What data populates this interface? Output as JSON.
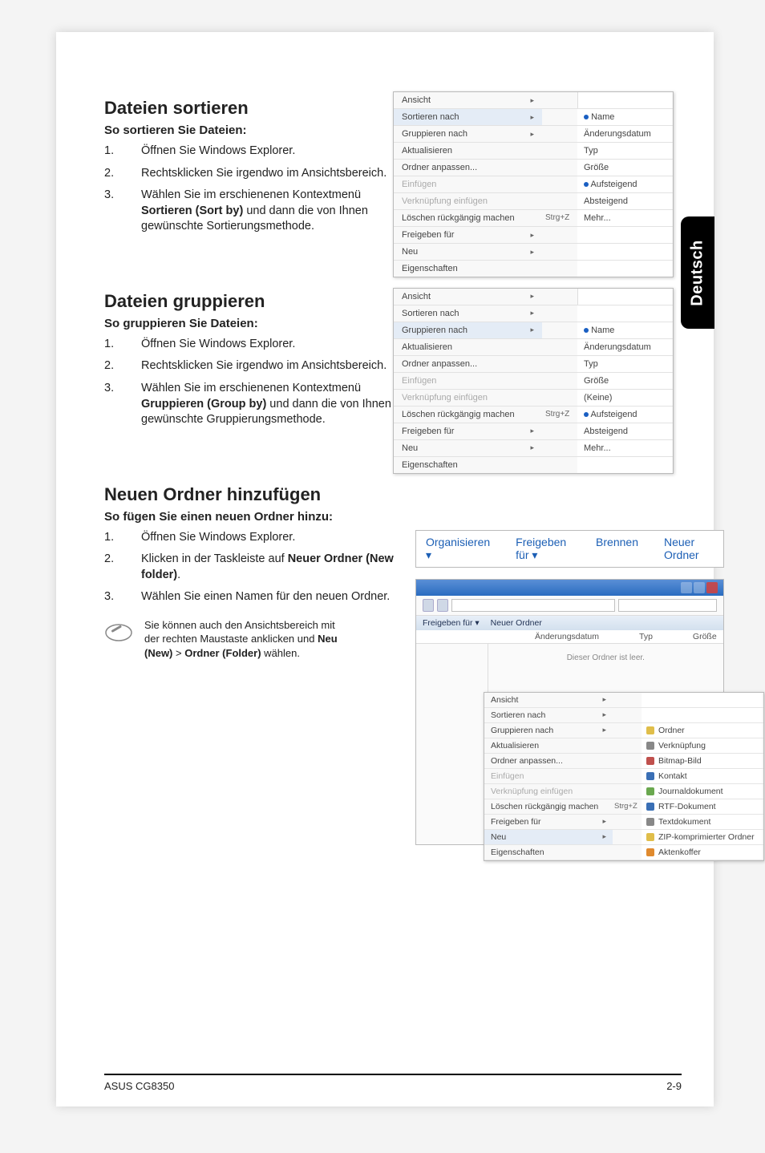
{
  "sideTab": "Deutsch",
  "sections": {
    "sort": {
      "heading": "Dateien sortieren",
      "subheading": "So sortieren Sie Dateien:",
      "steps": [
        "Öffnen Sie Windows Explorer.",
        "Rechtsklicken Sie irgendwo im Ansichtsbereich.",
        "Wählen Sie im erschienenen Kontextmenü Sortieren (Sort by) und dann die von Ihnen gewünschte Sortierungsmethode."
      ],
      "step3_pre": "Wählen Sie im erschienenen Kontextmenü ",
      "step3_bold": "Sortieren (Sort by)",
      "step3_post": " und dann die von Ihnen gewünschte Sortierungsmethode.",
      "menu": {
        "left": [
          "Ansicht",
          "Sortieren nach",
          "Gruppieren nach",
          "Aktualisieren",
          "Ordner anpassen...",
          "Einfügen",
          "Verknüpfung einfügen",
          "Löschen rückgängig machen",
          "Freigeben für",
          "Neu",
          "Eigenschaften"
        ],
        "shortcut": "Strg+Z",
        "right": [
          "Name",
          "Änderungsdatum",
          "Typ",
          "Größe",
          "Aufsteigend",
          "Absteigend",
          "Mehr..."
        ]
      }
    },
    "group": {
      "heading": "Dateien gruppieren",
      "subheading": "So gruppieren Sie Dateien:",
      "step3_pre": "Wählen Sie im erschienenen Kontextmenü ",
      "step3_bold": "Gruppieren (Group by)",
      "step3_post": " und dann die von Ihnen gewünschte Gruppierungsmethode.",
      "menu": {
        "left": [
          "Ansicht",
          "Sortieren nach",
          "Gruppieren nach",
          "Aktualisieren",
          "Ordner anpassen...",
          "Einfügen",
          "Verknüpfung einfügen",
          "Löschen rückgängig machen",
          "Freigeben für",
          "Neu",
          "Eigenschaften"
        ],
        "shortcut": "Strg+Z",
        "right": [
          "Name",
          "Änderungsdatum",
          "Typ",
          "Größe",
          "(Keine)",
          "Aufsteigend",
          "Absteigend",
          "Mehr..."
        ]
      }
    },
    "folder": {
      "heading": "Neuen Ordner hinzufügen",
      "subheading": "So fügen Sie einen neuen Ordner hinzu:",
      "steps": {
        "s1": "Öffnen Sie Windows Explorer.",
        "s2_pre": "Klicken in der Taskleiste auf ",
        "s2_bold": "Neuer Ordner (New folder)",
        "s2_post": ".",
        "s3": "Wählen Sie einen Namen für den neuen Ordner."
      },
      "toolbar": [
        "Organisieren ▾",
        "Freigeben für ▾",
        "Brennen",
        "Neuer Ordner"
      ],
      "explorer": {
        "tb": [
          "Freigeben für ▾",
          "Neuer Ordner"
        ],
        "cols": [
          "Änderungsdatum",
          "Typ",
          "Größe"
        ],
        "empty": "Dieser Ordner ist leer.",
        "menu_left": [
          "Ansicht",
          "Sortieren nach",
          "Gruppieren nach",
          "Aktualisieren",
          "Ordner anpassen...",
          "Einfügen",
          "Verknüpfung einfügen",
          "Löschen rückgängig machen",
          "Freigeben für",
          "Neu",
          "Eigenschaften"
        ],
        "shortcut": "Strg+Z",
        "menu_right": [
          "Ordner",
          "Verknüpfung",
          "Bitmap-Bild",
          "Kontakt",
          "Journaldokument",
          "RTF-Dokument",
          "Textdokument",
          "ZIP-komprimierter Ordner",
          "Aktenkoffer"
        ]
      },
      "note_pre": "Sie können auch den Ansichtsbereich mit der rechten Maustaste anklicken und ",
      "note_b1": "Neu (New)",
      "note_mid": " > ",
      "note_b2": "Ordner (Folder)",
      "note_post": " wählen."
    }
  },
  "footer": {
    "left": "ASUS CG8350",
    "right": "2-9"
  }
}
